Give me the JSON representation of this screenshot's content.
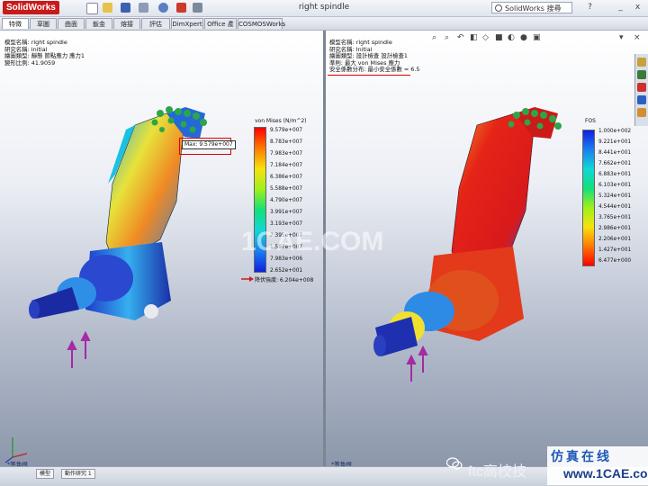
{
  "window": {
    "logo": "SolidWorks",
    "title": "right spindle",
    "search_placeholder": "SolidWorks 搜尋",
    "help_label": "?",
    "minimize_label": "_",
    "close_label": "x"
  },
  "tabs": [
    {
      "label": "特徵",
      "active": true
    },
    {
      "label": "草圖",
      "active": false
    },
    {
      "label": "曲面",
      "active": false
    },
    {
      "label": "鈑金",
      "active": false
    },
    {
      "label": "熔接",
      "active": false
    },
    {
      "label": "評估",
      "active": false
    },
    {
      "label": "DimXpert",
      "active": false
    },
    {
      "label": "Office 產品",
      "active": false
    },
    {
      "label": "COSMOSWorks",
      "active": false
    }
  ],
  "left_view": {
    "info_lines": [
      "模型名稱: right spindle",
      "研究名稱: Initial",
      "繪圖類型: 靜態 節點應力 應力1",
      "變形比例: 41.9059"
    ],
    "legend": {
      "title": "von Mises (N/m^2)",
      "ticks": [
        "9.579e+007",
        "8.783e+007",
        "7.983e+007",
        "7.184e+007",
        "6.386e+007",
        "5.588e+007",
        "4.790e+007",
        "3.991e+007",
        "3.193e+007",
        "2.395e+007",
        "1.597e+007",
        "7.983e+006",
        "2.652e+001"
      ],
      "yield_label": "降伏強度: 6.204e+008"
    },
    "max_label": "Max: 9.579e+007",
    "view_name": "*等角視"
  },
  "right_view": {
    "info_lines": [
      "模型名稱: right spindle",
      "研究名稱: Initial",
      "繪圖類型: 設計檢查 設計檢查1",
      "準則: 最大 von Mises 應力",
      "安全係數分布: 最小安全係數 = 6.5"
    ],
    "legend": {
      "title": "FOS",
      "ticks": [
        "1.000e+002",
        "9.221e+001",
        "8.441e+001",
        "7.662e+001",
        "6.883e+001",
        "6.103e+001",
        "5.324e+001",
        "4.544e+001",
        "3.765e+001",
        "2.986e+001",
        "2.206e+001",
        "1.427e+001",
        "6.477e+000"
      ]
    },
    "view_name": "*等角視"
  },
  "bottom_tabs": [
    "模型",
    "動作研究 1"
  ],
  "watermarks": {
    "center": "1CAE.COM",
    "ftc": "ftc高校技",
    "corner_top": "仿真在线",
    "corner_bottom": "www.1CAE.com"
  }
}
